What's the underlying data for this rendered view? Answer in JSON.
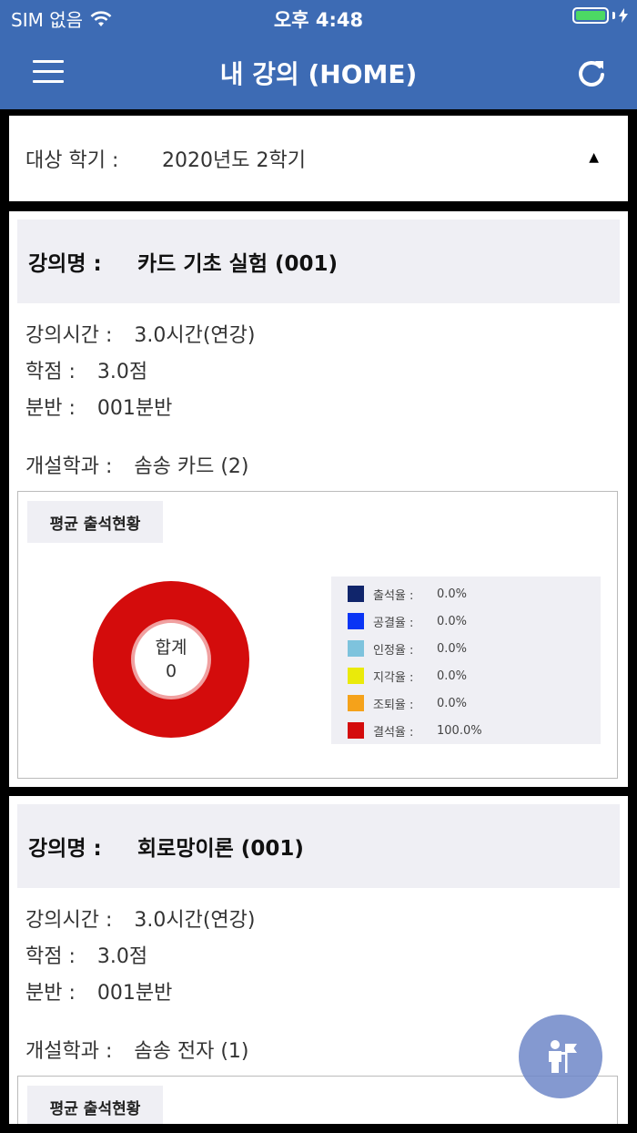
{
  "status_bar": {
    "carrier": "SIM 없음",
    "time": "오후 4:48"
  },
  "nav": {
    "title": "내 강의 (HOME)",
    "menu_icon": "hamburger-menu-icon",
    "refresh_icon": "refresh-icon"
  },
  "semester": {
    "label": "대상 학기 :",
    "value": "2020년도 2학기"
  },
  "courses": [
    {
      "name_label": "강의명 :",
      "name": "카드 기초 실험 (001)",
      "hours_label": "강의시간 :",
      "hours": "3.0시간(연강)",
      "credit_label": "학점 :",
      "credit": "3.0점",
      "section_label": "분반 :",
      "section": "001분반",
      "dept_label": "개설학과 :",
      "dept": "솜송 카드 (2)",
      "attendance_title": "평균 출석현황",
      "total_label": "합계",
      "total": "0",
      "legend": [
        {
          "label": "출석율 :",
          "value": "0.0%",
          "color": "#10256b"
        },
        {
          "label": "공결율 :",
          "value": "0.0%",
          "color": "#0a35f5"
        },
        {
          "label": "인정율 :",
          "value": "0.0%",
          "color": "#7ec3dd"
        },
        {
          "label": "지각율 :",
          "value": "0.0%",
          "color": "#eaea0a"
        },
        {
          "label": "조퇴율 :",
          "value": "0.0%",
          "color": "#f5a21a"
        },
        {
          "label": "결석율 :",
          "value": "100.0%",
          "color": "#d40c0c"
        }
      ]
    },
    {
      "name_label": "강의명 :",
      "name": "회로망이론 (001)",
      "hours_label": "강의시간 :",
      "hours": "3.0시간(연강)",
      "credit_label": "학점 :",
      "credit": "3.0점",
      "section_label": "분반 :",
      "section": "001분반",
      "dept_label": "개설학과 :",
      "dept": "솜송 전자 (1)",
      "attendance_title": "평균 출석현황"
    }
  ],
  "colors": {
    "header": "#3d6bb4",
    "absent": "#d40c0c",
    "fab": "#6e87c8"
  }
}
